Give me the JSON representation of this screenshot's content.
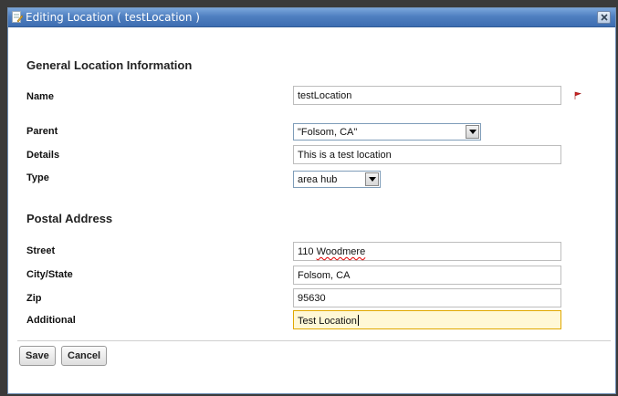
{
  "dialog": {
    "title": "Editing Location ( testLocation )"
  },
  "general": {
    "heading": "General Location Information",
    "name_label": "Name",
    "name_value": "testLocation",
    "parent_label": "Parent",
    "parent_value": "\"Folsom, CA\"",
    "details_label": "Details",
    "details_value": "This is a test location",
    "type_label": "Type",
    "type_value": "area hub"
  },
  "postal": {
    "heading": "Postal Address",
    "street_label": "Street",
    "street_number": "110 ",
    "street_name": "Woodmere",
    "city_label": "City/State",
    "city_value": "Folsom, CA",
    "zip_label": "Zip",
    "zip_value": "95630",
    "additional_label": "Additional",
    "additional_value": "Test Location"
  },
  "buttons": {
    "save": "Save",
    "cancel": "Cancel"
  },
  "colors": {
    "title_bar": "#4f7fc0",
    "active_field_bg": "#fff8d6",
    "active_field_border": "#e0a800",
    "required_marker": "#cc2222"
  },
  "icons": {
    "title": "document-edit-icon",
    "close": "close-icon",
    "required": "required-flag-icon",
    "dropdown": "chevron-down-icon"
  }
}
